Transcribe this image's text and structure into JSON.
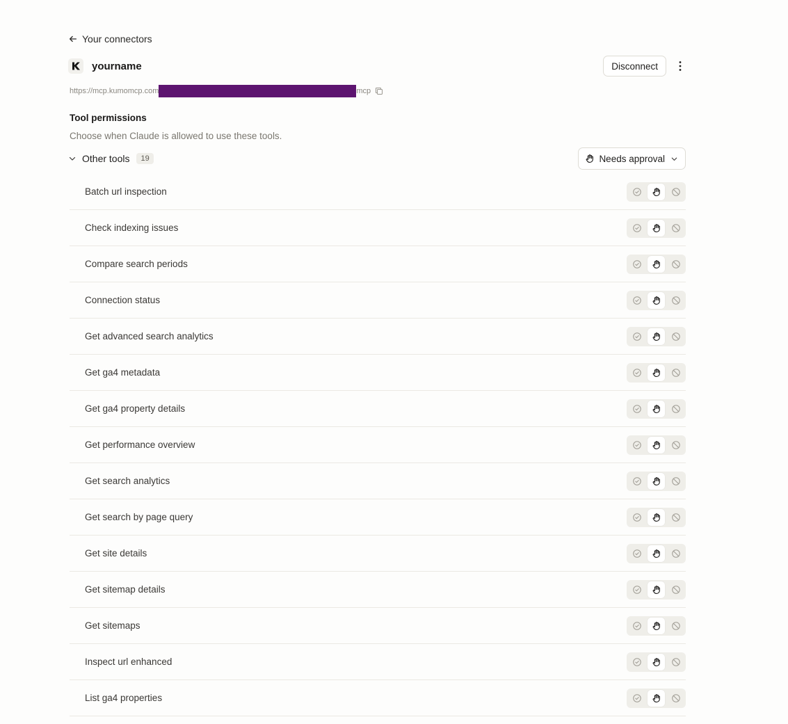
{
  "back_link": {
    "label": "Your connectors",
    "icon": "arrow-left-icon"
  },
  "connector": {
    "name": "yourname",
    "logo_letter": "K",
    "url_prefix": "https://mcp.kumomcp.com",
    "url_suffix": "mcp"
  },
  "actions": {
    "disconnect_label": "Disconnect"
  },
  "permissions": {
    "title": "Tool permissions",
    "description": "Choose when Claude is allowed to use these tools."
  },
  "group": {
    "label": "Other tools",
    "count": "19",
    "mode_label": "Needs approval"
  },
  "colors": {
    "background": "#fdfdfc",
    "redaction": "#5d1470",
    "segment_bg": "#efeee9",
    "divider": "#ebe9e3"
  },
  "tools": [
    {
      "name": "Batch url inspection",
      "mode": "needs-approval"
    },
    {
      "name": "Check indexing issues",
      "mode": "needs-approval"
    },
    {
      "name": "Compare search periods",
      "mode": "needs-approval"
    },
    {
      "name": "Connection status",
      "mode": "needs-approval"
    },
    {
      "name": "Get advanced search analytics",
      "mode": "needs-approval"
    },
    {
      "name": "Get ga4 metadata",
      "mode": "needs-approval"
    },
    {
      "name": "Get ga4 property details",
      "mode": "needs-approval"
    },
    {
      "name": "Get performance overview",
      "mode": "needs-approval"
    },
    {
      "name": "Get search analytics",
      "mode": "needs-approval"
    },
    {
      "name": "Get search by page query",
      "mode": "needs-approval"
    },
    {
      "name": "Get site details",
      "mode": "needs-approval"
    },
    {
      "name": "Get sitemap details",
      "mode": "needs-approval"
    },
    {
      "name": "Get sitemaps",
      "mode": "needs-approval"
    },
    {
      "name": "Inspect url enhanced",
      "mode": "needs-approval"
    },
    {
      "name": "List ga4 properties",
      "mode": "needs-approval"
    },
    {
      "name": "",
      "mode": "needs-approval"
    }
  ]
}
